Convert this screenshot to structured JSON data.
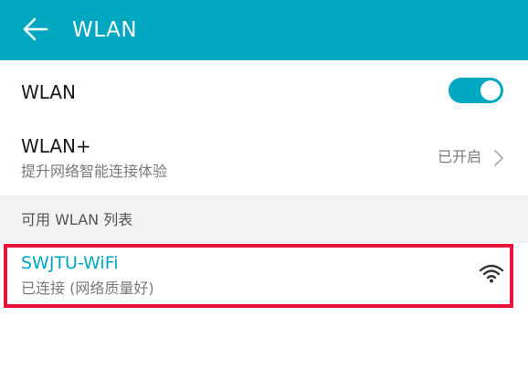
{
  "header": {
    "title": "WLAN",
    "back_icon": "arrow-left-icon",
    "background_color": "#00a7c0"
  },
  "wlan_row": {
    "label": "WLAN",
    "toggle_state": "on",
    "accent_color": "#00a7c0"
  },
  "wlan_plus_row": {
    "label": "WLAN+",
    "subtitle": "提升网络智能连接体验",
    "status": "已开启",
    "chevron_icon": "chevron-right-icon"
  },
  "section": {
    "title": "可用 WLAN 列表"
  },
  "networks": [
    {
      "name": "SWJTU-WiFi",
      "status": "已连接 (网络质量好)",
      "signal_icon": "wifi-signal-icon",
      "name_color": "#00a7c0",
      "highlight_color": "#e8123a"
    }
  ]
}
